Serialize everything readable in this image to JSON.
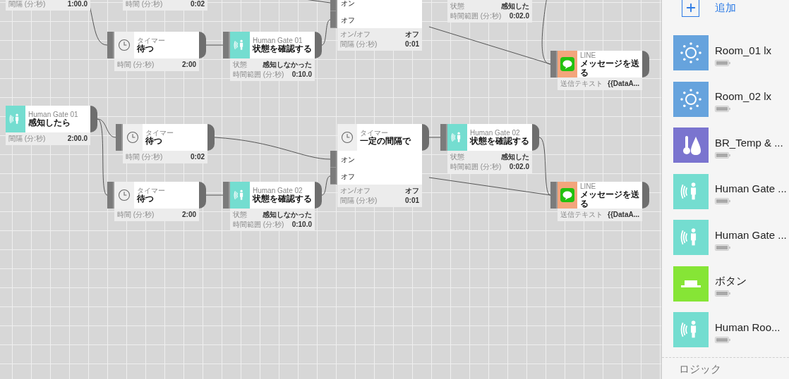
{
  "canvas": {
    "nodes": [
      {
        "kind": "trigger",
        "fields": [
          {
            "label": "間隔 (分:秒)",
            "value": "1:00.0"
          }
        ]
      },
      {
        "kind": "timer",
        "fields": [
          {
            "label": "時間 (分:秒)",
            "value": "0:02"
          }
        ]
      },
      {
        "kind": "toggle",
        "inputs": [
          "オン",
          "オフ"
        ],
        "fields": [
          {
            "label": "オン/オフ",
            "value": "オフ"
          },
          {
            "label": "間隔 (分:秒)",
            "value": "0:01"
          }
        ]
      },
      {
        "kind": "sensor",
        "fields": [
          {
            "label": "状態",
            "value": "感知した"
          },
          {
            "label": "時間範囲 (分:秒)",
            "value": "0:02.0"
          }
        ]
      },
      {
        "kind": "timer",
        "category": "タイマー",
        "title": "待つ",
        "fields": [
          {
            "label": "時間 (分:秒)",
            "value": "2:00"
          }
        ]
      },
      {
        "kind": "sensor",
        "category": "Human Gate 01",
        "title": "状態を確認する",
        "fields": [
          {
            "label": "状態",
            "value": "感知しなかった"
          },
          {
            "label": "時間範囲 (分:秒)",
            "value": "0:10.0"
          }
        ]
      },
      {
        "kind": "line",
        "category": "LINE",
        "title": "メッセージを送る",
        "fields": [
          {
            "label": "送信テキスト",
            "value": "{{DataA..."
          }
        ]
      },
      {
        "kind": "trigger",
        "category": "Human Gate 01",
        "title": "感知したら",
        "fields": [
          {
            "label": "間隔 (分:秒)",
            "value": "2:00.0"
          }
        ]
      },
      {
        "kind": "timer",
        "category": "タイマー",
        "title": "待つ",
        "fields": [
          {
            "label": "時間 (分:秒)",
            "value": "0:02"
          }
        ]
      },
      {
        "kind": "toggle",
        "category": "タイマー",
        "title": "一定の間隔で",
        "inputs": [
          "オン",
          "オフ"
        ],
        "fields": [
          {
            "label": "オン/オフ",
            "value": "オフ"
          },
          {
            "label": "間隔 (分:秒)",
            "value": "0:01"
          }
        ]
      },
      {
        "kind": "sensor",
        "category": "Human Gate 02",
        "title": "状態を確認する",
        "fields": [
          {
            "label": "状態",
            "value": "感知した"
          },
          {
            "label": "時間範囲 (分:秒)",
            "value": "0:02.0"
          }
        ]
      },
      {
        "kind": "timer",
        "category": "タイマー",
        "title": "待つ",
        "fields": [
          {
            "label": "時間 (分:秒)",
            "value": "2:00"
          }
        ]
      },
      {
        "kind": "sensor",
        "category": "Human Gate 02",
        "title": "状態を確認する",
        "fields": [
          {
            "label": "状態",
            "value": "感知しなかった"
          },
          {
            "label": "時間範囲 (分:秒)",
            "value": "0:10.0"
          }
        ]
      },
      {
        "kind": "line",
        "category": "LINE",
        "title": "メッセージを送る",
        "fields": [
          {
            "label": "送信テキスト",
            "value": "{{DataA..."
          }
        ]
      }
    ]
  },
  "sidebar": {
    "add_label": "追加",
    "devices": [
      {
        "name": "Room_01 lx",
        "kind": "light",
        "color": "#66a3dd"
      },
      {
        "name": "Room_02 lx",
        "kind": "light",
        "color": "#66a3dd"
      },
      {
        "name": "BR_Temp & ...",
        "kind": "climate",
        "color": "#7a74cf"
      },
      {
        "name": "Human Gate ...",
        "kind": "motion",
        "color": "#74ddd0"
      },
      {
        "name": "Human Gate ...",
        "kind": "motion",
        "color": "#74ddd0"
      },
      {
        "name": "ボタン",
        "kind": "button",
        "color": "#86e536"
      },
      {
        "name": "Human Roo...",
        "kind": "motion",
        "color": "#74ddd0"
      }
    ],
    "section_title": "ロジック"
  }
}
